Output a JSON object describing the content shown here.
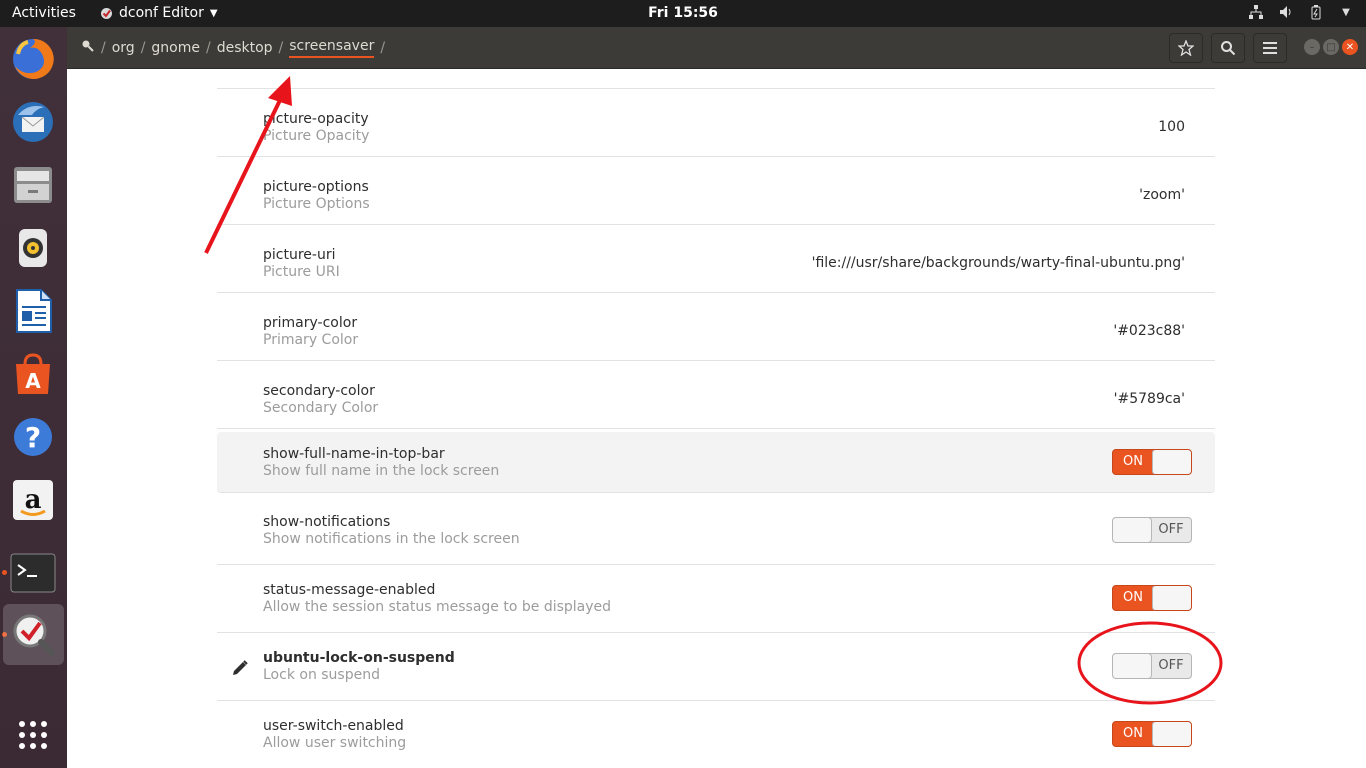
{
  "topbar": {
    "activities": "Activities",
    "app_name": "dconf Editor",
    "clock": "Fri 15:56"
  },
  "dock": {
    "items": [
      {
        "name": "firefox-icon"
      },
      {
        "name": "thunderbird-icon"
      },
      {
        "name": "files-icon"
      },
      {
        "name": "rhythmbox-icon"
      },
      {
        "name": "writer-icon"
      },
      {
        "name": "software-center-icon"
      },
      {
        "name": "help-icon"
      },
      {
        "name": "amazon-icon"
      },
      {
        "name": "terminal-icon"
      },
      {
        "name": "dconf-editor-icon"
      },
      {
        "name": "show-apps-icon"
      }
    ]
  },
  "header": {
    "path": [
      "org",
      "gnome",
      "desktop",
      "screensaver"
    ],
    "separator": "/"
  },
  "rows": [
    {
      "name": "picture-opacity",
      "desc": "Picture Opacity",
      "value": "100",
      "type": "value"
    },
    {
      "name": "picture-options",
      "desc": "Picture Options",
      "value": "'zoom'",
      "type": "value"
    },
    {
      "name": "picture-uri",
      "desc": "Picture URI",
      "value": "'file:///usr/share/backgrounds/warty-final-ubuntu.png'",
      "type": "value"
    },
    {
      "name": "primary-color",
      "desc": "Primary Color",
      "value": "'#023c88'",
      "type": "value"
    },
    {
      "name": "secondary-color",
      "desc": "Secondary Color",
      "value": "'#5789ca'",
      "type": "value"
    },
    {
      "name": "show-full-name-in-top-bar",
      "desc": "Show full name in the lock screen",
      "value": "ON",
      "type": "toggle"
    },
    {
      "name": "show-notifications",
      "desc": "Show notifications in the lock screen",
      "value": "OFF",
      "type": "toggle"
    },
    {
      "name": "status-message-enabled",
      "desc": "Allow the session status message to be displayed",
      "value": "ON",
      "type": "toggle"
    },
    {
      "name": "ubuntu-lock-on-suspend",
      "desc": "Lock on suspend",
      "value": "OFF",
      "type": "toggle"
    },
    {
      "name": "user-switch-enabled",
      "desc": "Allow user switching",
      "value": "ON",
      "type": "toggle"
    }
  ],
  "colors": {
    "accent": "#e95420",
    "annotation": "#e8141b"
  }
}
